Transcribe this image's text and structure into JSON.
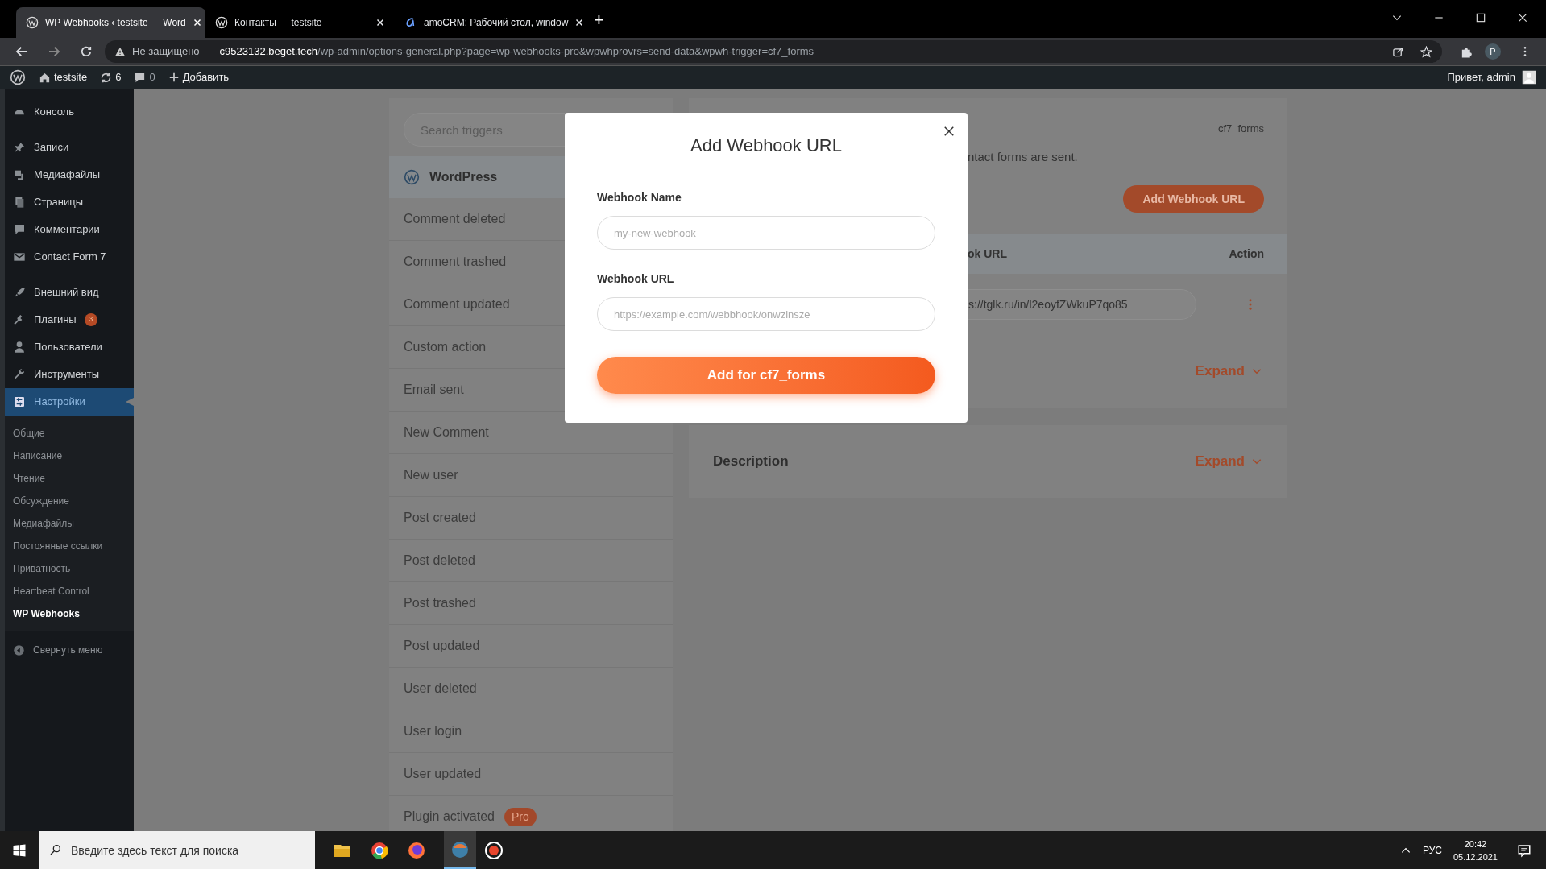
{
  "browser": {
    "tabs": [
      {
        "title": "WP Webhooks ‹ testsite — Word",
        "selected": true
      },
      {
        "title": "Контакты — testsite",
        "selected": false
      },
      {
        "title": "amoCRM: Рабочий стол, window",
        "selected": false
      }
    ],
    "new_tab": "+",
    "security": "Не защищено",
    "url_host": "c9523132.beget.tech",
    "url_path": "/wp-admin/options-general.php?page=wp-webhooks-pro&wpwhprovrs=send-data&wpwh-trigger=cf7_forms",
    "profile": "P"
  },
  "admin_bar": {
    "site": "testsite",
    "updates": "6",
    "comments": "0",
    "add": "Добавить",
    "greeting": "Привет, admin"
  },
  "sidebar": {
    "items": [
      {
        "label": "Консоль",
        "selected": false
      },
      {
        "label": "Записи",
        "selected": false
      },
      {
        "label": "Медиафайлы",
        "selected": false
      },
      {
        "label": "Страницы",
        "selected": false
      },
      {
        "label": "Комментарии",
        "selected": false
      },
      {
        "label": "Contact Form 7",
        "selected": false
      },
      {
        "label": "Внешний вид",
        "selected": false
      },
      {
        "label": "Плагины",
        "selected": false,
        "badge": "3"
      },
      {
        "label": "Пользователи",
        "selected": false
      },
      {
        "label": "Инструменты",
        "selected": false
      },
      {
        "label": "Настройки",
        "selected": true
      }
    ],
    "submenu": [
      {
        "label": "Общие",
        "selected": false
      },
      {
        "label": "Написание",
        "selected": false
      },
      {
        "label": "Чтение",
        "selected": false
      },
      {
        "label": "Обсуждение",
        "selected": false
      },
      {
        "label": "Медиафайлы",
        "selected": false
      },
      {
        "label": "Постоянные ссылки",
        "selected": false
      },
      {
        "label": "Приватность",
        "selected": false
      },
      {
        "label": "Heartbeat Control",
        "selected": false
      },
      {
        "label": "WP Webhooks",
        "selected": true
      }
    ],
    "collapse": "Свернуть меню"
  },
  "triggers": {
    "search_placeholder": "Search triggers",
    "group": "WordPress",
    "items": [
      {
        "label": "Comment deleted"
      },
      {
        "label": "Comment trashed"
      },
      {
        "label": "Comment updated"
      },
      {
        "label": "Custom action"
      },
      {
        "label": "Email sent"
      },
      {
        "label": "New Comment"
      },
      {
        "label": "New user"
      },
      {
        "label": "Post created"
      },
      {
        "label": "Post deleted"
      },
      {
        "label": "Post trashed"
      },
      {
        "label": "Post updated"
      },
      {
        "label": "User deleted"
      },
      {
        "label": "User login"
      },
      {
        "label": "User updated"
      },
      {
        "label": "Plugin activated",
        "badge": "Pro"
      }
    ]
  },
  "detail": {
    "trigger_id": "cf7_forms",
    "description": "ntact forms are sent.",
    "add_button": "Add Webhook URL",
    "columns": [
      "ok URL",
      "Action"
    ],
    "rows": [
      {
        "url": "s://tglk.ru/in/l2eoyfZWkuP7qo85"
      }
    ],
    "sections": [
      {
        "expand": "Expand"
      },
      {
        "title": "Description",
        "expand": "Expand"
      }
    ]
  },
  "modal": {
    "title": "Add Webhook URL",
    "fields": [
      {
        "label": "Webhook Name",
        "placeholder": "my-new-webhook"
      },
      {
        "label": "Webhook URL",
        "placeholder": "https://example.com/webbhook/onwzinsze"
      }
    ],
    "submit": "Add for cf7_forms"
  },
  "taskbar": {
    "search_placeholder": "Введите здесь текст для поиска",
    "language": "РУС",
    "time": "20:42",
    "date": "05.12.2021"
  }
}
